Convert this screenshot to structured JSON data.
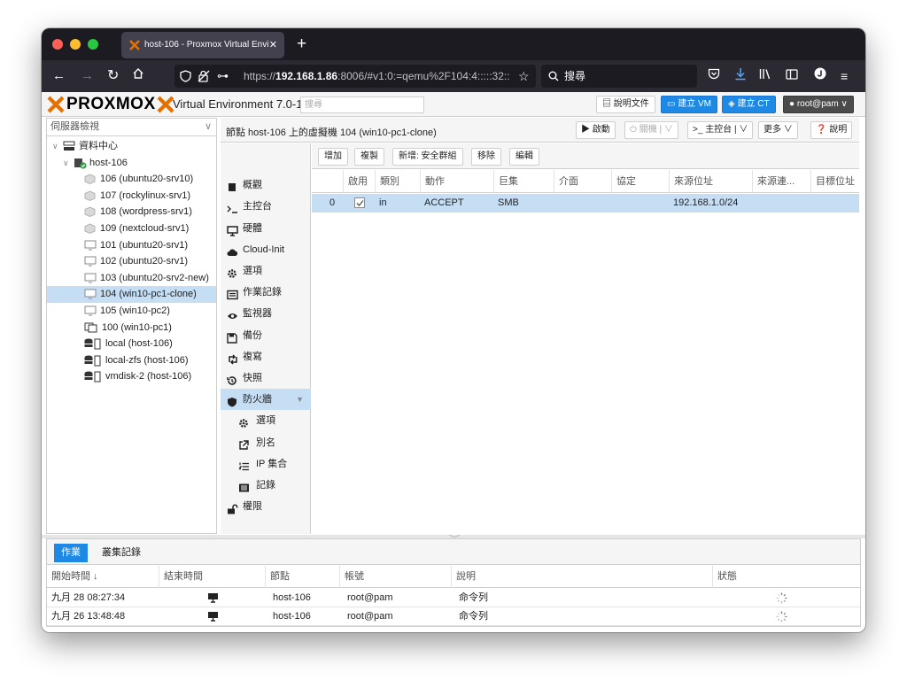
{
  "browser": {
    "tab_title": "host-106 - Proxmox Virtual Envi",
    "url_prefix": "https://",
    "url_host": "192.168.1.86",
    "url_rest": ":8006/#v1:0:=qemu%2F104:4:::::32::",
    "search_placeholder": "搜尋"
  },
  "header": {
    "logo_text": "PROXMOX",
    "title": "Virtual Environment 7.0-11",
    "search_placeholder": "搜尋",
    "docs_label": "說明文件",
    "create_vm_label": "建立 VM",
    "create_ct_label": "建立 CT",
    "user_label": "root@pam"
  },
  "tree": {
    "view_label": "伺服器檢視",
    "datacenter": "資料中心",
    "node": "host-106",
    "items": [
      {
        "label": "106 (ubuntu20-srv10)",
        "kind": "ct"
      },
      {
        "label": "107 (rockylinux-srv1)",
        "kind": "ct"
      },
      {
        "label": "108 (wordpress-srv1)",
        "kind": "ct"
      },
      {
        "label": "109 (nextcloud-srv1)",
        "kind": "ct"
      },
      {
        "label": "101 (ubuntu20-srv1)",
        "kind": "vm"
      },
      {
        "label": "102 (ubuntu20-srv1)",
        "kind": "vm"
      },
      {
        "label": "103 (ubuntu20-srv2-new)",
        "kind": "vm"
      },
      {
        "label": "104 (win10-pc1-clone)",
        "kind": "vm",
        "selected": true
      },
      {
        "label": "105 (win10-pc2)",
        "kind": "vm"
      },
      {
        "label": "100 (win10-pc1)",
        "kind": "template"
      },
      {
        "label": "local (host-106)",
        "kind": "storage"
      },
      {
        "label": "local-zfs (host-106)",
        "kind": "storage"
      },
      {
        "label": "vmdisk-2 (host-106)",
        "kind": "storage"
      }
    ]
  },
  "vm": {
    "title": "節點 host-106 上的虛擬機 104 (win10-pc1-clone)",
    "start_label": "啟動",
    "shutdown_label": "關機",
    "console_label": "主控台",
    "more_label": "更多",
    "help_label": "說明"
  },
  "menu": {
    "items": [
      {
        "label": "概觀",
        "icon": "book-icon"
      },
      {
        "label": "主控台",
        "icon": "terminal-icon"
      },
      {
        "label": "硬體",
        "icon": "desktop-icon"
      },
      {
        "label": "Cloud-Init",
        "icon": "cloud-icon"
      },
      {
        "label": "選項",
        "icon": "gear-icon"
      },
      {
        "label": "作業記錄",
        "icon": "list-icon"
      },
      {
        "label": "監視器",
        "icon": "eye-icon"
      },
      {
        "label": "備份",
        "icon": "floppy-icon"
      },
      {
        "label": "複寫",
        "icon": "retweet-icon"
      },
      {
        "label": "快照",
        "icon": "history-icon"
      },
      {
        "label": "防火牆",
        "icon": "shield-icon",
        "active": true
      },
      {
        "label": "選項",
        "icon": "gear-icon",
        "sub": true
      },
      {
        "label": "別名",
        "icon": "external-link-icon",
        "sub": true
      },
      {
        "label": "IP 集合",
        "icon": "list-ol-icon",
        "sub": true
      },
      {
        "label": "記錄",
        "icon": "list-alt-icon",
        "sub": true
      },
      {
        "label": "權限",
        "icon": "unlock-icon"
      }
    ]
  },
  "firewall": {
    "toolbar": {
      "add": "增加",
      "copy": "複製",
      "insert_group": "新增: 安全群組",
      "remove": "移除",
      "edit": "編輯"
    },
    "columns": [
      "",
      "啟用",
      "類別",
      "動作",
      "巨集",
      "介面",
      "協定",
      "來源位址",
      "來源連...",
      "目標位址"
    ],
    "rows": [
      {
        "pos": "0",
        "enabled": true,
        "type": "in",
        "action": "ACCEPT",
        "macro": "SMB",
        "iface": "",
        "proto": "",
        "source": "192.168.1.0/24",
        "sport": "",
        "dest": ""
      }
    ]
  },
  "tasks": {
    "tab_tasks": "作業",
    "tab_cluster_log": "叢集記錄",
    "columns": [
      "開始時間 ↓",
      "結束時間",
      "節點",
      "帳號",
      "說明",
      "狀態"
    ],
    "rows": [
      {
        "start": "九月 28 08:27:34",
        "end": "",
        "node": "host-106",
        "user": "root@pam",
        "desc": "命令列",
        "status": "running"
      },
      {
        "start": "九月 26 13:48:48",
        "end": "",
        "node": "host-106",
        "user": "root@pam",
        "desc": "命令列",
        "status": "running"
      }
    ]
  },
  "colors": {
    "accent": "#1e88e5",
    "selection": "#c5def4",
    "logo_orange": "#e57000"
  }
}
